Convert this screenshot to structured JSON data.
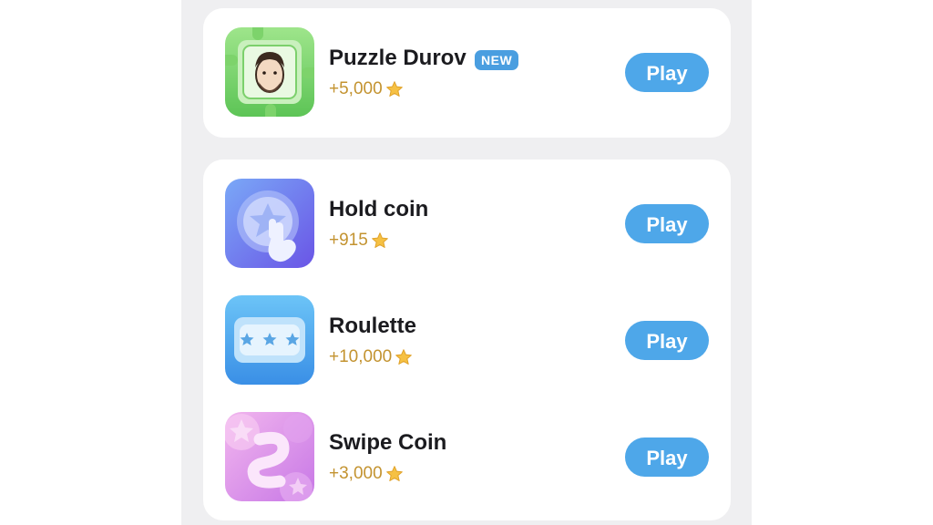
{
  "games_top": [
    {
      "id": "puzzle-durov",
      "title": "Puzzle Durov",
      "badge": "NEW",
      "reward": "+5,000",
      "icon": "portrait-puzzle-icon",
      "play_label": "Play"
    }
  ],
  "games_list": [
    {
      "id": "hold-coin",
      "title": "Hold coin",
      "reward": "+915",
      "icon": "star-coin-tap-icon",
      "play_label": "Play"
    },
    {
      "id": "roulette",
      "title": "Roulette",
      "reward": "+10,000",
      "icon": "star-slot-icon",
      "play_label": "Play"
    },
    {
      "id": "swipe-coin",
      "title": "Swipe Coin",
      "reward": "+3,000",
      "icon": "swipe-star-icon",
      "play_label": "Play"
    }
  ],
  "colors": {
    "accent": "#4ea7e9",
    "reward": "#c39330",
    "badge": "#4a9ee0",
    "background": "#efeff1"
  }
}
